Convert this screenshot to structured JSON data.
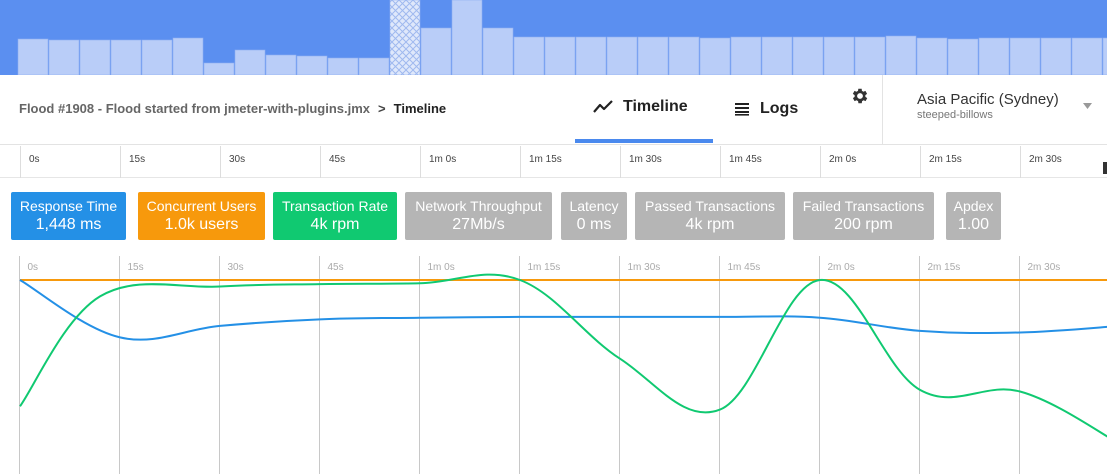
{
  "overview": {
    "bars": [
      0.48,
      0.47,
      0.47,
      0.47,
      0.47,
      0.49,
      0.16,
      0.33,
      0.27,
      0.25,
      0.23,
      0.23,
      0.23,
      0.63,
      1.0,
      0.62,
      0.51,
      0.51,
      0.51,
      0.5,
      0.5,
      0.5,
      0.49,
      0.5,
      0.5,
      0.5,
      0.5,
      0.5,
      0.52,
      0.49,
      0.48,
      0.49,
      0.49,
      0.49,
      0.49,
      0.49
    ],
    "selected_index": 12,
    "colors": {
      "background": "#5b8ff0",
      "bar": "#b9cdf8",
      "bar_stroke": "#8fb0f2"
    }
  },
  "header": {
    "breadcrumb": {
      "flood": "Flood #1908 - Flood started from jmeter-with-plugins.jmx",
      "separator": ">",
      "current": "Timeline"
    },
    "tabs": [
      {
        "label": "Timeline",
        "icon": "timeline-chart-icon",
        "active": true
      },
      {
        "label": "Logs",
        "icon": "list-icon",
        "active": false
      }
    ],
    "settings_icon": "gear-icon",
    "region": {
      "name": "Asia Pacific (Sydney)",
      "sub": "steeped-billows",
      "icon": "dropdown-arrow-icon"
    }
  },
  "ruler": {
    "ticks": [
      "0s",
      "15s",
      "30s",
      "45s",
      "1m 0s",
      "1m 15s",
      "1m 30s",
      "1m 45s",
      "2m 0s",
      "2m 15s",
      "2m 30s"
    ]
  },
  "metrics": [
    {
      "label": "Response Time",
      "value": "1,448 ms",
      "color": "#2490e6"
    },
    {
      "label": "Concurrent Users",
      "value": "1.0k users",
      "color": "#f7990c"
    },
    {
      "label": "Transaction Rate",
      "value": "4k rpm",
      "color": "#10c971"
    },
    {
      "label": "Network Throughput",
      "value": "27Mb/s",
      "color": "#b5b5b5"
    },
    {
      "label": "Latency",
      "value": "0 ms",
      "color": "#b5b5b5"
    },
    {
      "label": "Passed Transactions",
      "value": "4k rpm",
      "color": "#b5b5b5"
    },
    {
      "label": "Failed Transactions",
      "value": "200 rpm",
      "color": "#b5b5b5"
    },
    {
      "label": "Apdex",
      "value": "1.00",
      "color": "#b5b5b5"
    }
  ],
  "chart_data": {
    "type": "line",
    "x_ticks": [
      "0s",
      "15s",
      "30s",
      "45s",
      "1m 0s",
      "1m 15s",
      "1m 30s",
      "1m 45s",
      "2m 0s",
      "2m 15s",
      "2m 30s"
    ],
    "x_seconds": [
      0,
      15,
      30,
      45,
      60,
      75,
      90,
      105,
      120,
      135,
      150
    ],
    "series": [
      {
        "name": "Concurrent Users",
        "color": "#f7990c",
        "points": [
          [
            0,
            1.0
          ],
          [
            165,
            1.0
          ]
        ]
      },
      {
        "name": "Response Time",
        "color": "#2490e6",
        "points": [
          [
            0,
            1.0
          ],
          [
            15,
            0.65
          ],
          [
            30,
            0.72
          ],
          [
            45,
            0.76
          ],
          [
            60,
            0.77
          ],
          [
            75,
            0.775
          ],
          [
            90,
            0.775
          ],
          [
            105,
            0.775
          ],
          [
            120,
            0.77
          ],
          [
            135,
            0.69
          ],
          [
            150,
            0.68
          ],
          [
            165,
            0.72
          ]
        ]
      },
      {
        "name": "Transaction Rate",
        "color": "#10c971",
        "points": [
          [
            0,
            0.23
          ],
          [
            12,
            0.9
          ],
          [
            30,
            0.96
          ],
          [
            45,
            0.975
          ],
          [
            60,
            0.98
          ],
          [
            75,
            1.0
          ],
          [
            90,
            0.52
          ],
          [
            105,
            0.21
          ],
          [
            120,
            1.0
          ],
          [
            135,
            0.33
          ],
          [
            150,
            0.32
          ],
          [
            165,
            0.0
          ]
        ]
      }
    ],
    "ylim": [
      0,
      1.05
    ],
    "grid": true
  }
}
